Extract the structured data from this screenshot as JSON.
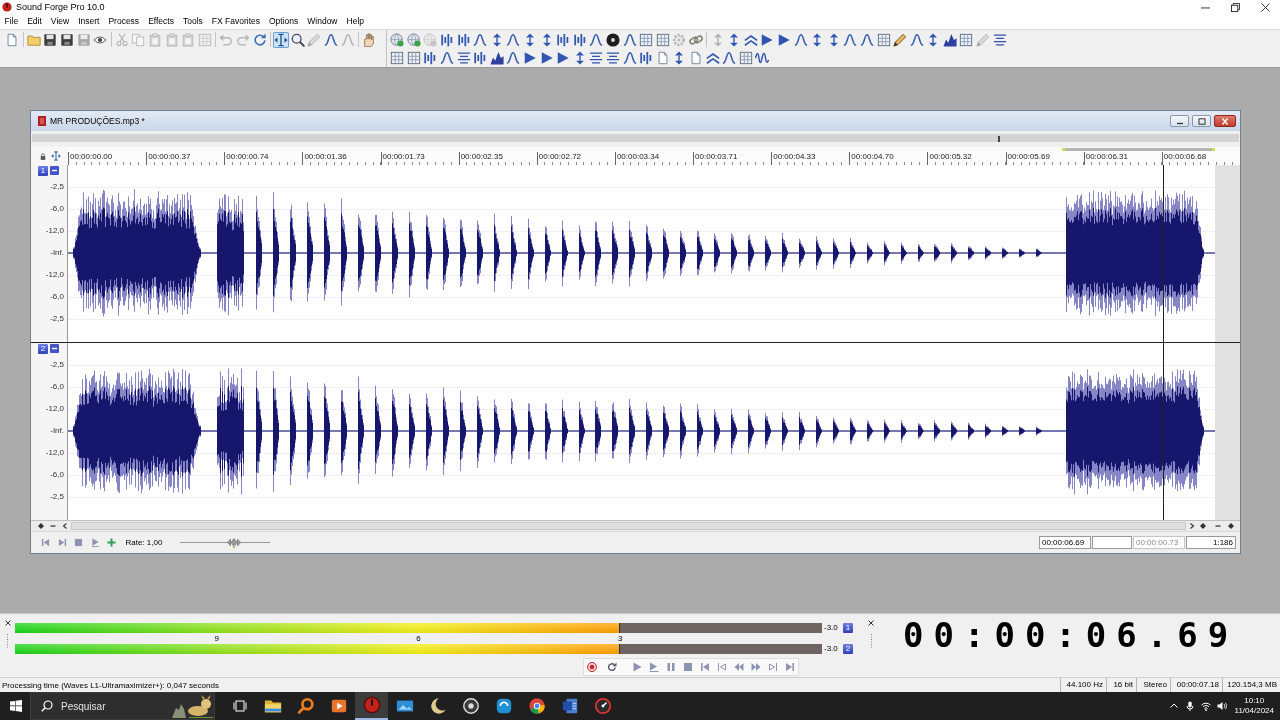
{
  "app": {
    "title": "Sound Forge Pro 10.0"
  },
  "menu": [
    "File",
    "Edit",
    "View",
    "Insert",
    "Process",
    "Effects",
    "Tools",
    "FX Favorites",
    "Options",
    "Window",
    "Help"
  ],
  "toolbars": {
    "main": [
      [
        {
          "kind": "document",
          "disabled": false,
          "pressed": false
        }
      ],
      [
        {
          "kind": "folder",
          "disabled": false,
          "pressed": false
        },
        {
          "kind": "disk",
          "disabled": false,
          "pressed": false
        },
        {
          "kind": "disk",
          "disabled": false,
          "pressed": false
        },
        {
          "kind": "disk",
          "disabled": true,
          "pressed": false
        },
        {
          "kind": "eye",
          "disabled": false,
          "pressed": false
        }
      ],
      [
        {
          "kind": "scissors",
          "disabled": true,
          "pressed": false
        },
        {
          "kind": "copy",
          "disabled": true,
          "pressed": false
        },
        {
          "kind": "clipboard",
          "disabled": true,
          "pressed": false
        },
        {
          "kind": "clipboard",
          "disabled": true,
          "pressed": false
        },
        {
          "kind": "clipboard",
          "disabled": true,
          "pressed": false
        },
        {
          "kind": "grid",
          "disabled": true,
          "pressed": false
        }
      ],
      [
        {
          "kind": "undo",
          "disabled": true,
          "pressed": false
        },
        {
          "kind": "redo",
          "disabled": true,
          "pressed": false
        },
        {
          "kind": "refresh",
          "disabled": false,
          "pressed": false
        }
      ],
      [
        {
          "kind": "cursor",
          "disabled": false,
          "pressed": true
        },
        {
          "kind": "magnifier",
          "disabled": false,
          "pressed": false
        },
        {
          "kind": "pencil",
          "disabled": true,
          "pressed": false
        },
        {
          "kind": "curve",
          "disabled": false,
          "pressed": false
        },
        {
          "kind": "curve",
          "disabled": true,
          "pressed": false
        }
      ],
      [
        {
          "kind": "hand",
          "disabled": false,
          "pressed": false
        }
      ]
    ],
    "effects": [
      [
        {
          "kind": "globe",
          "disabled": false
        },
        {
          "kind": "globe",
          "disabled": false
        },
        {
          "kind": "globe",
          "disabled": true
        },
        {
          "kind": "bars",
          "disabled": false
        },
        {
          "kind": "bars",
          "disabled": false
        },
        {
          "kind": "curve",
          "disabled": false
        },
        {
          "kind": "arrows",
          "disabled": false
        },
        {
          "kind": "curve",
          "disabled": false
        },
        {
          "kind": "arrows",
          "disabled": false
        },
        {
          "kind": "arrows",
          "disabled": false
        },
        {
          "kind": "bars",
          "disabled": false
        },
        {
          "kind": "bars",
          "disabled": false
        },
        {
          "kind": "curve",
          "disabled": false
        },
        {
          "kind": "disc",
          "disabled": false
        },
        {
          "kind": "curve",
          "disabled": false
        },
        {
          "kind": "grid",
          "disabled": false
        },
        {
          "kind": "grid",
          "disabled": false
        },
        {
          "kind": "gear",
          "disabled": true
        },
        {
          "kind": "chain",
          "disabled": false
        }
      ],
      [
        {
          "kind": "arrows",
          "disabled": true
        },
        {
          "kind": "arrows",
          "disabled": false
        },
        {
          "kind": "chevrons",
          "disabled": false
        },
        {
          "kind": "triangle",
          "disabled": false
        },
        {
          "kind": "triangle",
          "disabled": false
        },
        {
          "kind": "curve",
          "disabled": false
        },
        {
          "kind": "arrows",
          "disabled": false
        },
        {
          "kind": "arrows",
          "disabled": false
        },
        {
          "kind": "curve",
          "disabled": false
        },
        {
          "kind": "curve",
          "disabled": false
        },
        {
          "kind": "grid",
          "disabled": false
        },
        {
          "kind": "pencil",
          "disabled": false
        },
        {
          "kind": "curve",
          "disabled": false
        },
        {
          "kind": "arrows",
          "disabled": false
        },
        {
          "kind": "mountain",
          "disabled": false
        },
        {
          "kind": "grid",
          "disabled": false
        },
        {
          "kind": "pencil",
          "disabled": true
        },
        {
          "kind": "lines",
          "disabled": false
        }
      ]
    ],
    "process": [
      [
        {
          "kind": "grid",
          "disabled": false
        },
        {
          "kind": "grid",
          "disabled": false
        },
        {
          "kind": "bars",
          "disabled": false
        },
        {
          "kind": "curve",
          "disabled": false
        },
        {
          "kind": "lines",
          "disabled": false
        },
        {
          "kind": "bars",
          "disabled": false
        },
        {
          "kind": "mountain",
          "disabled": false
        },
        {
          "kind": "curve",
          "disabled": false
        },
        {
          "kind": "triangle",
          "disabled": false
        },
        {
          "kind": "triangle",
          "disabled": false
        },
        {
          "kind": "triangle",
          "disabled": false
        },
        {
          "kind": "arrows",
          "disabled": false
        },
        {
          "kind": "lines",
          "disabled": false
        },
        {
          "kind": "lines",
          "disabled": false
        },
        {
          "kind": "curve",
          "disabled": false
        },
        {
          "kind": "bars",
          "disabled": false
        },
        {
          "kind": "document",
          "disabled": false
        },
        {
          "kind": "arrows",
          "disabled": false
        },
        {
          "kind": "document",
          "disabled": false
        },
        {
          "kind": "chevrons",
          "disabled": false
        },
        {
          "kind": "curve",
          "disabled": false
        },
        {
          "kind": "grid",
          "disabled": false
        },
        {
          "kind": "wave",
          "disabled": false
        }
      ]
    ]
  },
  "data_window": {
    "title": "MR PRODUÇÕES.mp3 *",
    "ruler": [
      "00:00:00.00",
      "00:00:00.37",
      "00:00:00.74",
      "00:00:01.36",
      "00:00:01.73",
      "00:00:02.35",
      "00:00:02.72",
      "00:00:03.34",
      "00:00:03.71",
      "00:00:04.33",
      "00:00:04.70",
      "00:00:05.32",
      "00:00:05.69",
      "00:00:06.31",
      "00:00:06.68"
    ],
    "channels": [
      {
        "number": "1",
        "scale": [
          "-2,5",
          "-6,0",
          "-12,0",
          "-Inf.",
          "-12,0",
          "-6,0",
          "-2,5"
        ]
      },
      {
        "number": "2",
        "scale": [
          "-2,5",
          "-6,0",
          "-12,0",
          "-Inf.",
          "-12,0",
          "-6,0",
          "-2,5"
        ]
      }
    ],
    "rate": {
      "label": "Rate: 1,00",
      "level": 0.59
    },
    "fields": [
      {
        "value": "00:00:06.69",
        "disabled": false
      },
      {
        "disabled": false
      },
      {
        "value": "00:00:00.73",
        "disabled": true
      },
      {
        "value": "1:186",
        "disabled": false
      }
    ]
  },
  "meters": {
    "scale": [
      "9",
      "6",
      "3"
    ],
    "channels": [
      {
        "number": "1",
        "level": 0.75,
        "reading": "-3.0"
      },
      {
        "number": "2",
        "level": 0.75,
        "reading": "-3.0"
      }
    ]
  },
  "time_display": "00:00:06.69",
  "status_bar": {
    "message": "Processing time (Waves L1-Ultramaximizer+): 0,047 seconds",
    "cells": [
      "44.100 Hz",
      "16 bit",
      "Stereo",
      "00:00:07.18",
      "120.154,3 MB"
    ]
  },
  "taskbar": {
    "search": {
      "placeholder": "Pesquisar"
    },
    "apps": [
      {
        "kind": "folder",
        "active": false
      },
      {
        "kind": "search",
        "active": false
      },
      {
        "kind": "media",
        "active": false
      },
      {
        "kind": "forge",
        "active": true
      },
      {
        "kind": "photos",
        "active": false
      },
      {
        "kind": "moon",
        "active": false
      },
      {
        "kind": "ring",
        "active": false
      },
      {
        "kind": "chat",
        "active": false
      },
      {
        "kind": "browser",
        "active": false
      },
      {
        "kind": "word",
        "active": false
      },
      {
        "kind": "recorder",
        "active": false
      }
    ],
    "clock": {
      "time": "10:10",
      "date": "11/04/2024"
    }
  }
}
